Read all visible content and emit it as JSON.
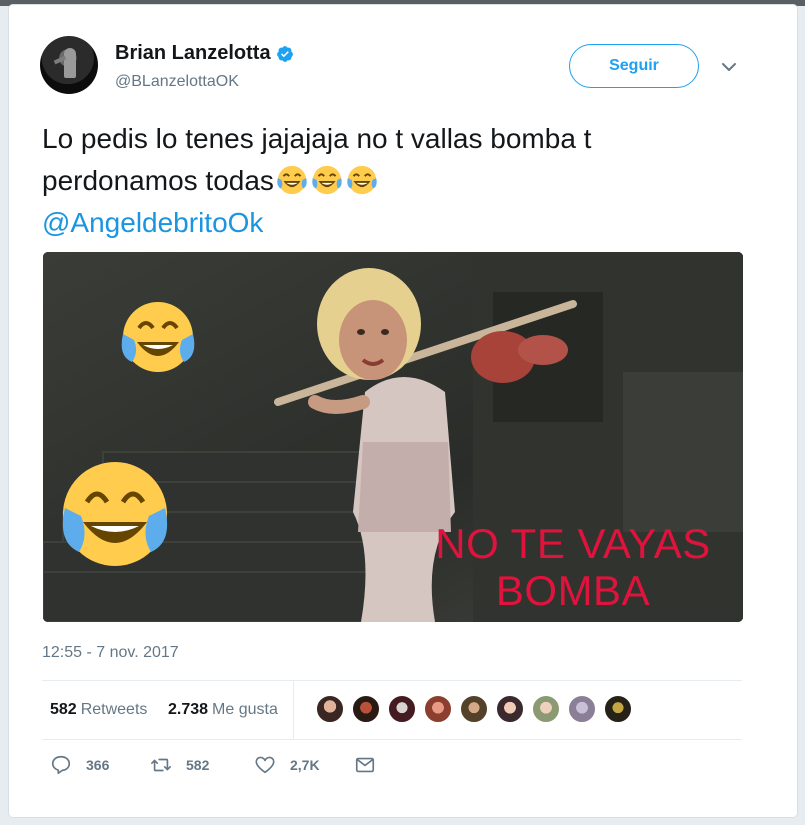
{
  "author": {
    "display_name": "Brian Lanzelotta",
    "handle": "@BLanzelottaOK",
    "verified": true
  },
  "header": {
    "follow_label": "Seguir"
  },
  "tweet": {
    "text_line1": "Lo pedis lo tenes jajajaja no t vallas bomba t",
    "text_line2": "perdonamos todas",
    "emoji": [
      "face-with-tears-of-joy",
      "face-with-tears-of-joy",
      "face-with-tears-of-joy"
    ],
    "mention": "@AngeldebritoOk",
    "media_caption_line1": "NO TE VAYAS",
    "media_caption_line2": "BOMBA",
    "timestamp": "12:55 - 7 nov. 2017"
  },
  "stats": {
    "retweets_count": "582",
    "retweets_label": "Retweets",
    "likes_count": "2.738",
    "likes_label": "Me gusta"
  },
  "actions": {
    "reply_count": "366",
    "retweet_count": "582",
    "like_count": "2,7K"
  },
  "colors": {
    "brand_blue": "#1da1f2",
    "mention_blue": "#1b95e0",
    "caption_red": "#e0133d",
    "muted_gray": "#657786"
  }
}
